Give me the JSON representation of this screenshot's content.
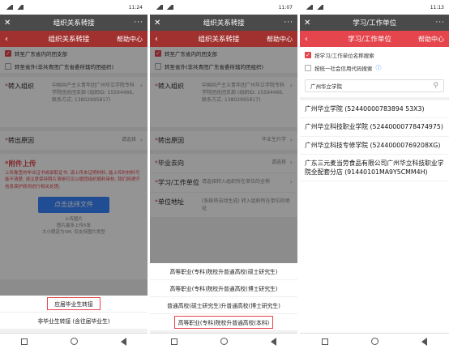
{
  "screen1": {
    "status_time": "11:24",
    "title": "组织关系转接",
    "subtitle": "组织关系转接",
    "help": "帮助中心",
    "check1": "转至广东省内的团支部",
    "check2": "转至省外(非共青团广东省委所辖的团组织)",
    "transfer_in_label": "转入组织",
    "transfer_in_value": "中国共产主义青年团广州华立学院专科学院团总团支部 (组织ID: 15594466, 联系方式: 13802995817)",
    "reason_label": "转出原因",
    "reason_value": "请选择",
    "attach_title": "附件上传",
    "warn_text": "上传像签的毕业证书或录取证书, 请上传本证明材料, 能上传的材料可能不清楚, 请注意保持照片清晰可见以便团组织顺利审核, 我们将遵守信息保护原则进行相关处理。",
    "choose_file": "点击选择文件",
    "hint1": "上传图片",
    "hint2": "图片最多上传5张",
    "hint3": "大小限定为5M, 仅支持图片类型",
    "option_selected": "应届毕业生转接",
    "option_other": "非毕业生转接 (含往届毕业生)"
  },
  "screen2": {
    "status_time": "11:07",
    "title": "组织关系转接",
    "subtitle": "组织关系转接",
    "help": "帮助中心",
    "check1": "转至广东省内的团支部",
    "check2": "转至省外(非共青团广东省委所辖的团组织)",
    "transfer_in_label": "转入组织",
    "transfer_in_value": "中国共产主义青年团广州华立学院专科学院团总团支部 (组织ID: 15594466, 联系方式: 13802995817)",
    "reason_label": "转出原因",
    "reason_value": "毕业生升学",
    "destination_label": "毕业去向",
    "destination_value": "请选择",
    "unit_label": "学习/工作单位",
    "unit_value": "请选择转入组织所在单位的全称",
    "address_label": "单位地址",
    "address_value": "(系统将自动生成) 转入组织所在单位的地址",
    "options": [
      "高等职业(专科)院校升普通高校(硕士研究生)",
      "高等职业(专科)院校升普通高校(博士研究生)",
      "普通高校(硕士研究生)升普通高校(博士研究生)",
      "高等职业(专科)院校升普通高校(本科)"
    ]
  },
  "screen3": {
    "status_time": "11:13",
    "title": "学习/工作单位",
    "subtitle": "学习/工作单位",
    "help": "帮助中心",
    "check1": "按学习/工作单位名称搜索",
    "check2": "按统一社会信用代码搜索",
    "search_value": "广州华立学院",
    "results": [
      "广州华立学院 (52440000783894 53X3)",
      "广州华立科技职业学院 (52440000778474975)",
      "广州华立科技专修学院 (52440000769208XG)",
      "广东三元麦当劳食品有限公司广州华立科技职业学院全配套分店 (91440101MA9Y5CMM4H)"
    ]
  },
  "colors": {
    "accent": "#e5454d",
    "button": "#3a86ff"
  }
}
